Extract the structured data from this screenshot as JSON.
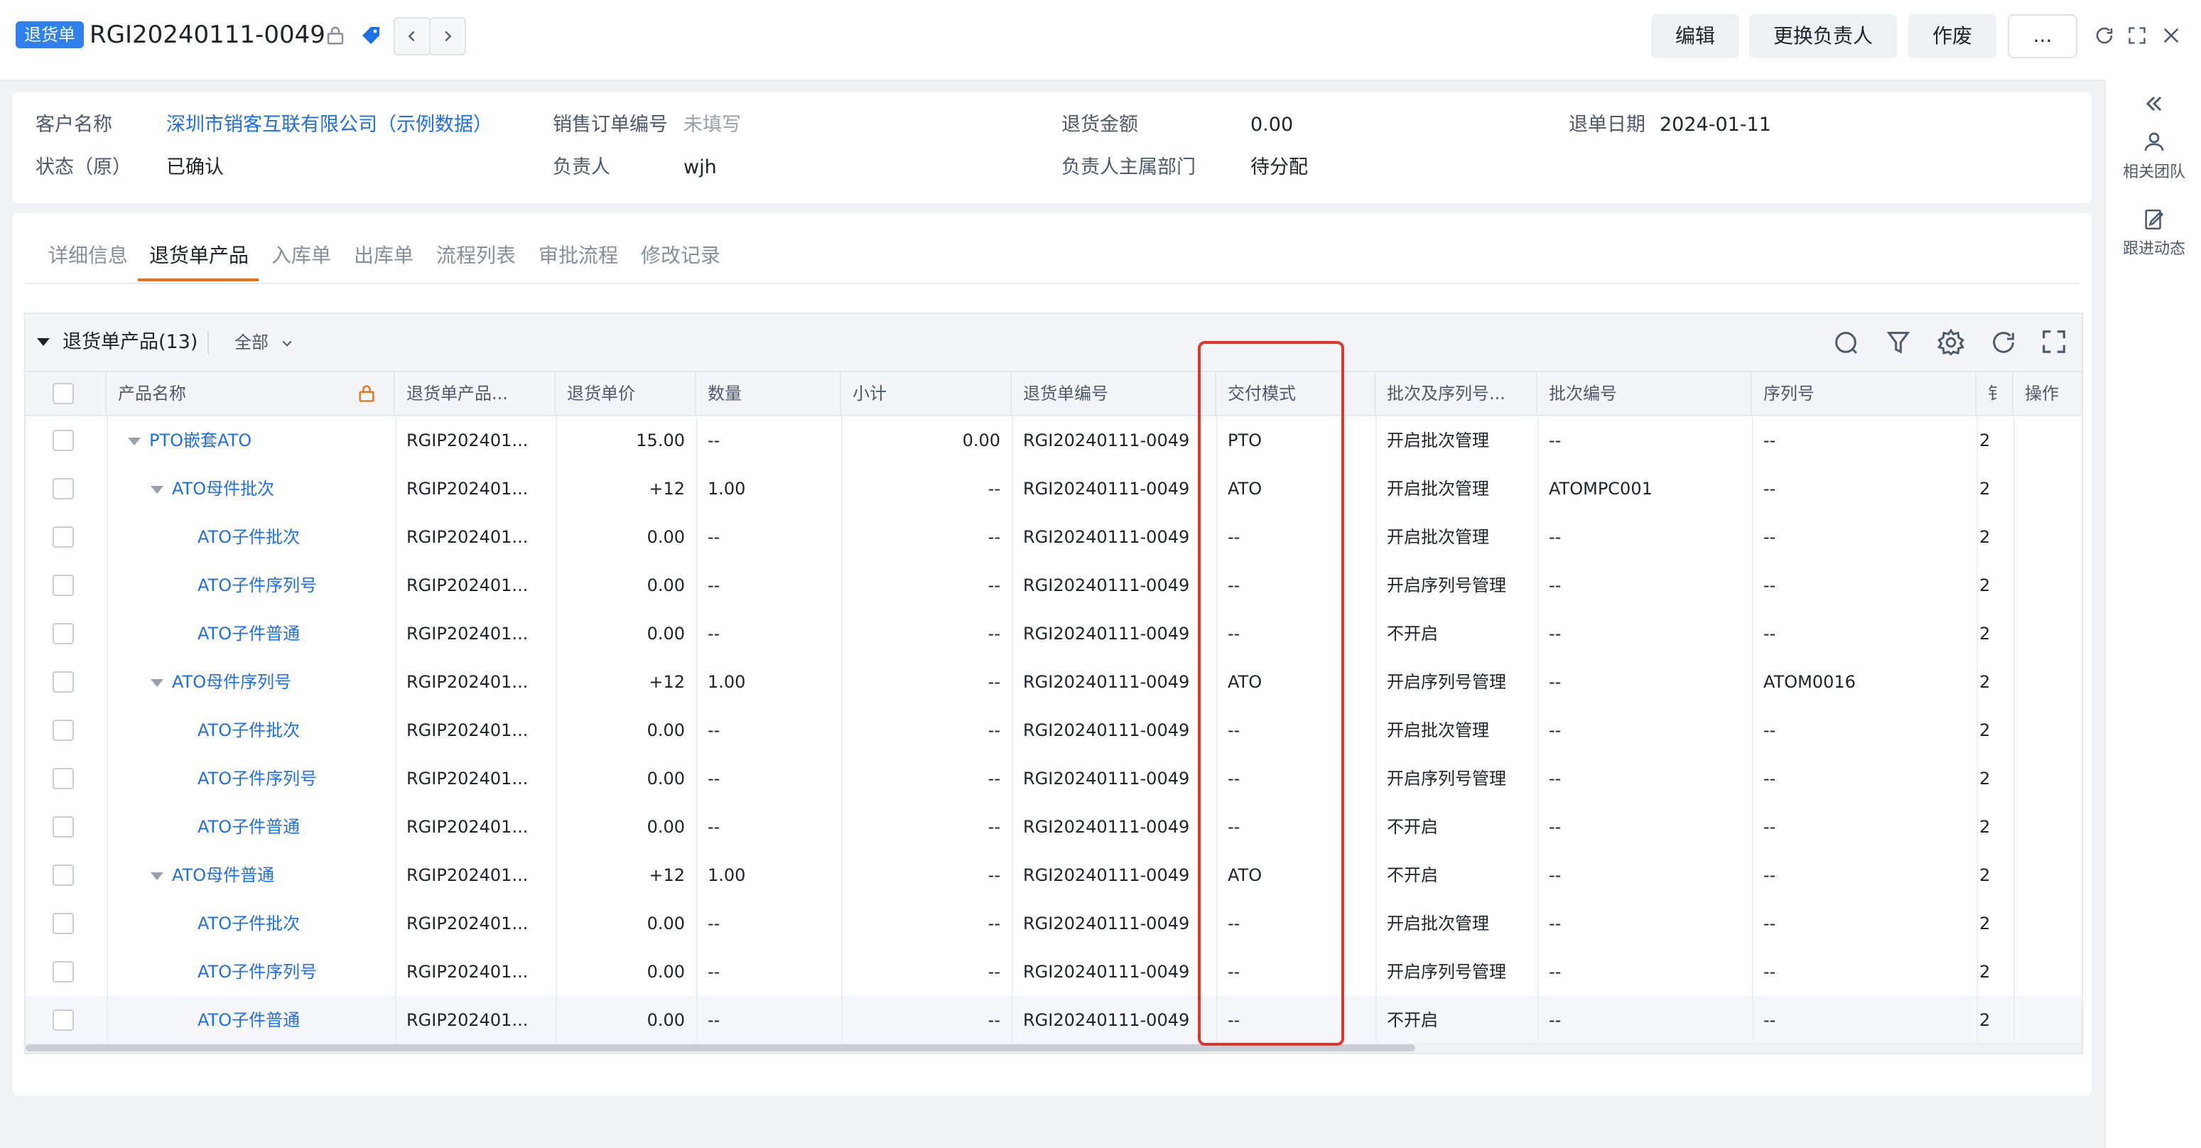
{
  "header": {
    "doc_type_tag": "退货单",
    "doc_number": "RGI20240111-0049",
    "buttons": {
      "edit": "编辑",
      "change_owner": "更换负责人",
      "void": "作废",
      "more": "..."
    }
  },
  "info": {
    "customer_label": "客户名称",
    "customer_value": "深圳市销客互联有限公司（示例数据）",
    "sales_order_label": "销售订单编号",
    "sales_order_value": "未填写",
    "return_amount_label": "退货金额",
    "return_amount_value": "0.00",
    "return_date_label": "退单日期",
    "return_date_value": "2024-01-11",
    "status_label": "状态（原）",
    "status_value": "已确认",
    "owner_label": "负责人",
    "owner_value": "wjh",
    "owner_dept_label": "负责人主属部门",
    "owner_dept_value": "待分配"
  },
  "rail": {
    "team": "相关团队",
    "follow": "跟进动态"
  },
  "tabs": [
    "详细信息",
    "退货单产品",
    "入库单",
    "出库单",
    "流程列表",
    "审批流程",
    "修改记录"
  ],
  "grid": {
    "title": "退货单产品(13)",
    "filter": "全部",
    "columns": [
      "产品名称",
      "退货单产品...",
      "退货单价",
      "数量",
      "小计",
      "退货单编号",
      "交付模式",
      "批次及序列号...",
      "批次编号",
      "序列号",
      "钅",
      "操作"
    ],
    "rows": [
      {
        "name": "PTO嵌套ATO",
        "level": 0,
        "caret": true,
        "code": "RGIP202401...",
        "price": "15.00",
        "qty": "--",
        "subtotal": "0.00",
        "doc": "RGI20240111-0049",
        "mode": "PTO",
        "batch_mgmt": "开启批次管理",
        "batch_no": "--",
        "serial": "--",
        "extra": "2"
      },
      {
        "name": "ATO母件批次",
        "level": 1,
        "caret": true,
        "code": "RGIP202401...",
        "price": "+12",
        "qty": "1.00",
        "subtotal": "--",
        "doc": "RGI20240111-0049",
        "mode": "ATO",
        "batch_mgmt": "开启批次管理",
        "batch_no": "ATOMPC001",
        "serial": "--",
        "extra": "2"
      },
      {
        "name": "ATO子件批次",
        "level": 2,
        "caret": false,
        "code": "RGIP202401...",
        "price": "0.00",
        "qty": "--",
        "subtotal": "--",
        "doc": "RGI20240111-0049",
        "mode": "--",
        "batch_mgmt": "开启批次管理",
        "batch_no": "--",
        "serial": "--",
        "extra": "2"
      },
      {
        "name": "ATO子件序列号",
        "level": 2,
        "caret": false,
        "code": "RGIP202401...",
        "price": "0.00",
        "qty": "--",
        "subtotal": "--",
        "doc": "RGI20240111-0049",
        "mode": "--",
        "batch_mgmt": "开启序列号管理",
        "batch_no": "--",
        "serial": "--",
        "extra": "2"
      },
      {
        "name": "ATO子件普通",
        "level": 2,
        "caret": false,
        "code": "RGIP202401...",
        "price": "0.00",
        "qty": "--",
        "subtotal": "--",
        "doc": "RGI20240111-0049",
        "mode": "--",
        "batch_mgmt": "不开启",
        "batch_no": "--",
        "serial": "--",
        "extra": "2"
      },
      {
        "name": "ATO母件序列号",
        "level": 1,
        "caret": true,
        "code": "RGIP202401...",
        "price": "+12",
        "qty": "1.00",
        "subtotal": "--",
        "doc": "RGI20240111-0049",
        "mode": "ATO",
        "batch_mgmt": "开启序列号管理",
        "batch_no": "--",
        "serial": "ATOM0016",
        "extra": "2"
      },
      {
        "name": "ATO子件批次",
        "level": 2,
        "caret": false,
        "code": "RGIP202401...",
        "price": "0.00",
        "qty": "--",
        "subtotal": "--",
        "doc": "RGI20240111-0049",
        "mode": "--",
        "batch_mgmt": "开启批次管理",
        "batch_no": "--",
        "serial": "--",
        "extra": "2"
      },
      {
        "name": "ATO子件序列号",
        "level": 2,
        "caret": false,
        "code": "RGIP202401...",
        "price": "0.00",
        "qty": "--",
        "subtotal": "--",
        "doc": "RGI20240111-0049",
        "mode": "--",
        "batch_mgmt": "开启序列号管理",
        "batch_no": "--",
        "serial": "--",
        "extra": "2"
      },
      {
        "name": "ATO子件普通",
        "level": 2,
        "caret": false,
        "code": "RGIP202401...",
        "price": "0.00",
        "qty": "--",
        "subtotal": "--",
        "doc": "RGI20240111-0049",
        "mode": "--",
        "batch_mgmt": "不开启",
        "batch_no": "--",
        "serial": "--",
        "extra": "2"
      },
      {
        "name": "ATO母件普通",
        "level": 1,
        "caret": true,
        "code": "RGIP202401...",
        "price": "+12",
        "qty": "1.00",
        "subtotal": "--",
        "doc": "RGI20240111-0049",
        "mode": "ATO",
        "batch_mgmt": "不开启",
        "batch_no": "--",
        "serial": "--",
        "extra": "2"
      },
      {
        "name": "ATO子件批次",
        "level": 2,
        "caret": false,
        "code": "RGIP202401...",
        "price": "0.00",
        "qty": "--",
        "subtotal": "--",
        "doc": "RGI20240111-0049",
        "mode": "--",
        "batch_mgmt": "开启批次管理",
        "batch_no": "--",
        "serial": "--",
        "extra": "2"
      },
      {
        "name": "ATO子件序列号",
        "level": 2,
        "caret": false,
        "code": "RGIP202401...",
        "price": "0.00",
        "qty": "--",
        "subtotal": "--",
        "doc": "RGI20240111-0049",
        "mode": "--",
        "batch_mgmt": "开启序列号管理",
        "batch_no": "--",
        "serial": "--",
        "extra": "2"
      },
      {
        "name": "ATO子件普通",
        "level": 2,
        "caret": false,
        "code": "RGIP202401...",
        "price": "0.00",
        "qty": "--",
        "subtotal": "--",
        "doc": "RGI20240111-0049",
        "mode": "--",
        "batch_mgmt": "不开启",
        "batch_no": "--",
        "serial": "--",
        "extra": "2"
      }
    ]
  },
  "colors": {
    "accent": "#1f6fe5",
    "tag": "#2f80ed",
    "tab_active": "#e8701a",
    "highlight": "#e0352b"
  },
  "icons": [
    "lock-icon",
    "tag-icon",
    "chevron-left-icon",
    "chevron-right-icon",
    "refresh-icon",
    "expand-icon",
    "close-icon",
    "double-chevron-left-icon",
    "team-icon",
    "follow-icon",
    "search-icon",
    "filter-icon",
    "settings-icon",
    "fullscreen-icon"
  ]
}
